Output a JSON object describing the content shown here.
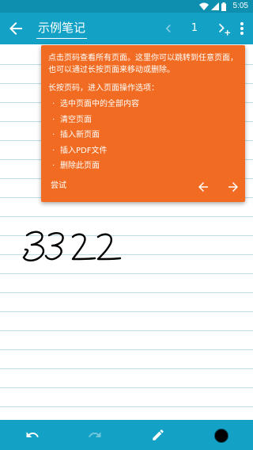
{
  "status_bar": {
    "time": "5:05"
  },
  "app_bar": {
    "title": "示例笔记",
    "page_number": "1"
  },
  "tooltip": {
    "intro": "点击页码查看所有页面。这里你可以跳转到任意页面，也可以通过长按页面来移动或删除。",
    "long_press": "长按页码，进入页面操作选项：",
    "options": [
      "选中页面中的全部内容",
      "清空页面",
      "插入新页面",
      "插入PDF文件",
      "删除此页面"
    ],
    "bullet": "·",
    "try_label": "尝试"
  },
  "canvas": {
    "handwritten_text": "3322"
  },
  "bottom_bar": {
    "pen_color": "#000000"
  },
  "colors": {
    "app_bar": "#13a1c6",
    "status_bar": "#0f8fb0",
    "tooltip": "#f16c22",
    "ruled_line": "#b8dcea"
  },
  "icons": {
    "back": "arrow-left-icon",
    "prev_page": "chevron-left-icon",
    "next_add_page": "chevron-right-plus-icon",
    "menu": "more-vert-icon",
    "undo": "undo-icon",
    "redo": "redo-icon",
    "pen": "pencil-icon",
    "color": "color-circle-icon",
    "wifi": "wifi-icon",
    "signal": "signal-icon",
    "battery": "battery-icon"
  }
}
